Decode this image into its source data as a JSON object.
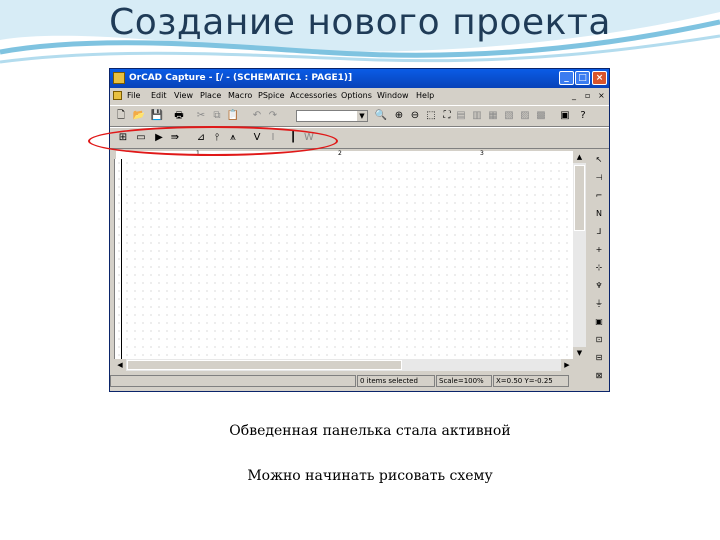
{
  "slide": {
    "title": "Создание нового проекта",
    "caption1": "Обведенная панелька стала активной",
    "caption2": "Можно начинать рисовать схему"
  },
  "window": {
    "title": "OrCAD Capture - [/ - (SCHEMATIC1 : PAGE1)]",
    "min": "_",
    "max": "□",
    "close": "×"
  },
  "menu": {
    "items": [
      "File",
      "Edit",
      "View",
      "Place",
      "Macro",
      "PSpice",
      "Accessories",
      "Options",
      "Window",
      "Help"
    ],
    "mdi_controls": [
      "_",
      "▫",
      "×"
    ]
  },
  "ruler": {
    "marks": [
      "1",
      "2",
      "3"
    ]
  },
  "status": {
    "items": "0 items selected",
    "scale": "Scale=100%",
    "coords": "X=0.50  Y=-0.25"
  },
  "colors": {
    "titlebar": "#0a52d8",
    "highlight": "#e01818",
    "slide_title": "#1f3b57"
  }
}
